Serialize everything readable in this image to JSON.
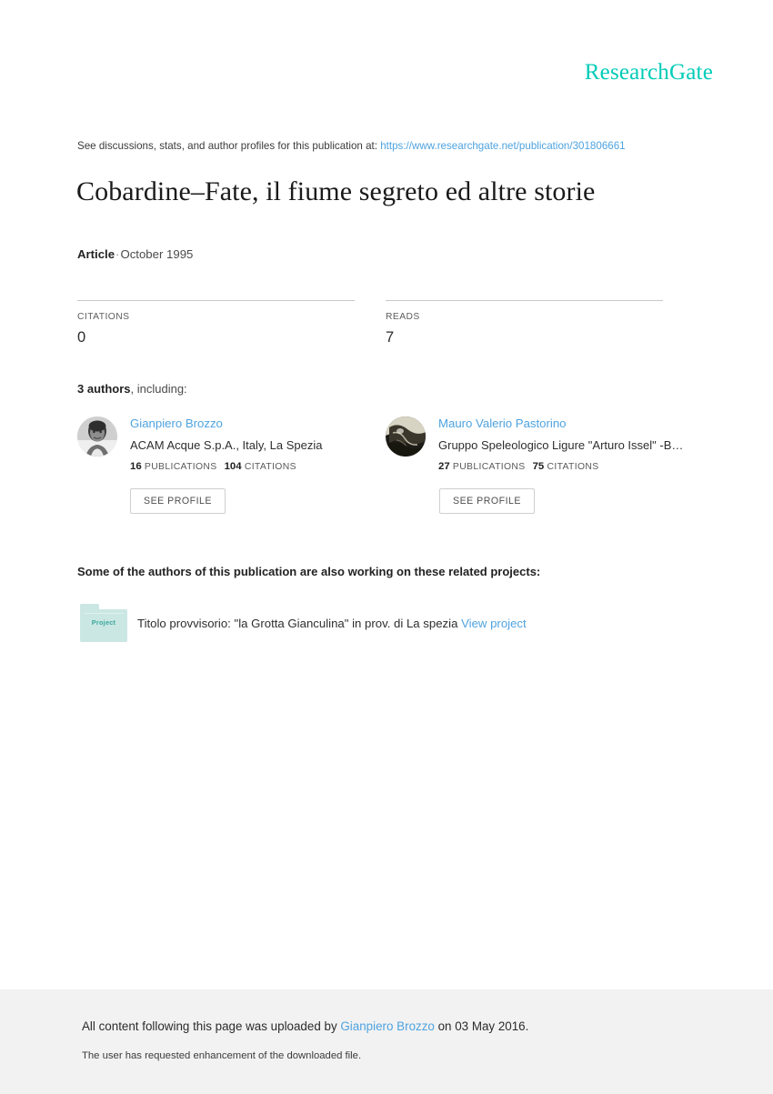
{
  "brand": {
    "logo_text": "ResearchGate",
    "logo_color": "#00ccb7",
    "link_color": "#4ea3e0"
  },
  "header": {
    "discussions_prefix": "See discussions, stats, and author profiles for this publication at:",
    "publication_url": "https://www.researchgate.net/publication/301806661"
  },
  "publication": {
    "title": "Cobardine–Fate, il fiume segreto ed altre storie",
    "type": "Article",
    "separator": "·",
    "date": "October 1995"
  },
  "stats": [
    {
      "label": "CITATIONS",
      "value": "0"
    },
    {
      "label": "READS",
      "value": "7"
    }
  ],
  "authors_section": {
    "count_text": "3 authors",
    "suffix_text": ", including:",
    "authors": [
      {
        "name": "Gianpiero Brozzo",
        "affiliation": "ACAM Acque S.p.A., Italy, La Spezia",
        "publications_count": "16",
        "publications_label": "PUBLICATIONS",
        "citations_count": "104",
        "citations_label": "CITATIONS",
        "button_label": "SEE PROFILE",
        "avatar_name": "author-avatar-photo"
      },
      {
        "name": "Mauro Valerio Pastorino",
        "affiliation": "Gruppo Speleologico Ligure \"Arturo Issel\" -B…",
        "publications_count": "27",
        "publications_label": "PUBLICATIONS",
        "citations_count": "75",
        "citations_label": "CITATIONS",
        "button_label": "SEE PROFILE",
        "avatar_name": "author-avatar-photo"
      }
    ]
  },
  "projects_section": {
    "heading": "Some of the authors of this publication are also working on these related projects:",
    "projects": [
      {
        "icon_label": "Project",
        "title": "Titolo provvisorio: \"la Grotta Gianculina\" in prov. di La spezia",
        "view_link_label": "View project"
      }
    ]
  },
  "footer": {
    "upload_prefix": "All content following this page was uploaded by",
    "uploader": "Gianpiero Brozzo",
    "upload_suffix": "on 03 May 2016.",
    "enhancement_note": "The user has requested enhancement of the downloaded file."
  }
}
